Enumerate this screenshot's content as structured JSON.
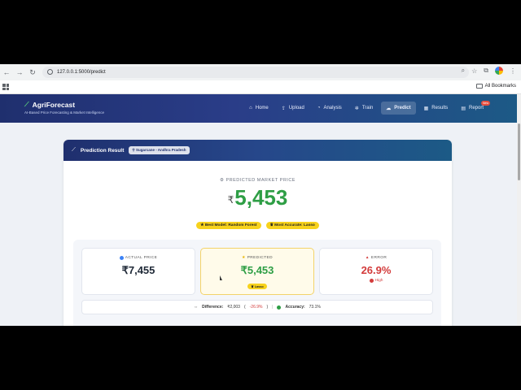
{
  "browser": {
    "url": "127.0.0.1:5000/predict",
    "bookmarks_label": "All Bookmarks"
  },
  "app": {
    "brand": "AgriForecast",
    "tagline": "AI-Based Price Forecasting & Market Intelligence",
    "nav": [
      {
        "label": "Home",
        "icon": "home-icon",
        "glyph": "⌂"
      },
      {
        "label": "Upload",
        "icon": "upload-icon",
        "glyph": "⇪"
      },
      {
        "label": "Analysis",
        "icon": "analysis-icon",
        "glyph": "◔"
      },
      {
        "label": "Train",
        "icon": "brain-icon",
        "glyph": "✲"
      },
      {
        "label": "Predict",
        "icon": "magic-icon",
        "glyph": "☁"
      },
      {
        "label": "Results",
        "icon": "table-icon",
        "glyph": "▦"
      },
      {
        "label": "Report",
        "icon": "file-icon",
        "glyph": "▤",
        "badge": "New"
      }
    ],
    "active_nav": "Predict"
  },
  "result": {
    "header_title": "Prediction Result",
    "crop_chip": "Sugarcane - Andhra Pradesh",
    "predicted_label": "PREDICTED MARKET PRICE",
    "currency": "₹",
    "predicted_value": "5,453",
    "best_model": "Best Model: Random Forest",
    "most_accurate": "Most Accurate: Lasso"
  },
  "metrics": {
    "actual": {
      "label": "ACTUAL PRICE",
      "value": "₹7,455"
    },
    "predicted": {
      "label": "PREDICTED",
      "value": "₹5,453",
      "model": "Lasso"
    },
    "error": {
      "label": "ERROR",
      "value": "26.9%",
      "level": "High"
    },
    "difference_label": "Difference:",
    "difference_value": "₹2,003",
    "difference_pct": "-26.9%",
    "accuracy_label": "Accuracy:",
    "accuracy_value": "73.1%"
  },
  "colors": {
    "header_start": "#1f2f6e",
    "header_end": "#1c5a86",
    "price_green": "#2e9e45",
    "error_red": "#d33b3b",
    "badge_yellow": "#f7d21c"
  }
}
